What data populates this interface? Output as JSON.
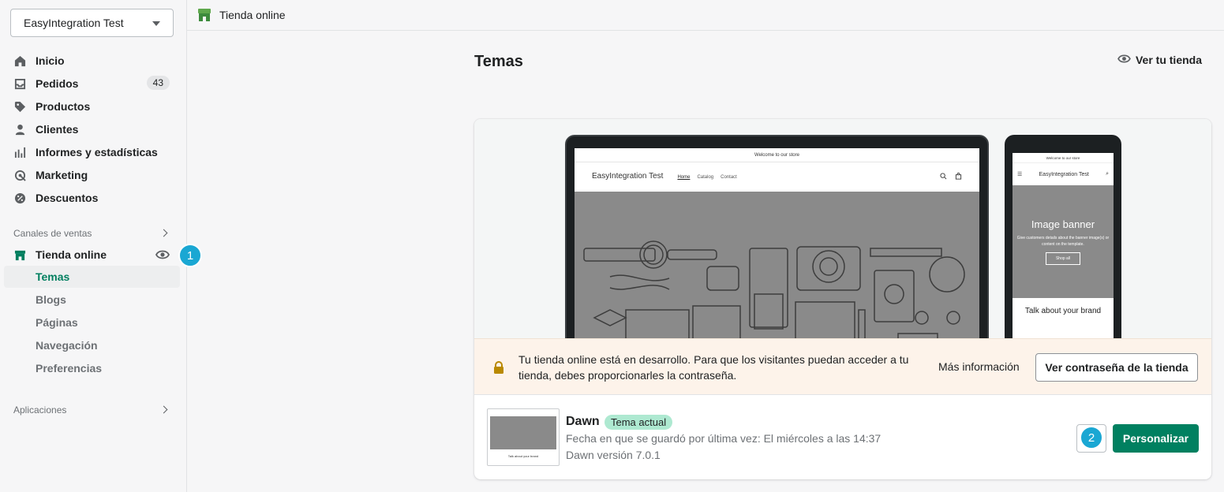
{
  "sidebar": {
    "store_name": "EasyIntegration Test",
    "items": [
      {
        "label": "Inicio",
        "icon": "home-icon"
      },
      {
        "label": "Pedidos",
        "icon": "orders-icon",
        "badge": "43"
      },
      {
        "label": "Productos",
        "icon": "tag-icon"
      },
      {
        "label": "Clientes",
        "icon": "person-icon"
      },
      {
        "label": "Informes y estadísticas",
        "icon": "bar-chart-icon"
      },
      {
        "label": "Marketing",
        "icon": "target-icon"
      },
      {
        "label": "Descuentos",
        "icon": "discount-icon"
      }
    ],
    "sales_channels_label": "Canales de ventas",
    "online_store_label": "Tienda online",
    "sub_items": [
      "Temas",
      "Blogs",
      "Páginas",
      "Navegación",
      "Preferencias"
    ],
    "apps_label": "Aplicaciones",
    "step1": "1"
  },
  "topbar": {
    "title": "Tienda online"
  },
  "main": {
    "page_title": "Temas",
    "view_store": "Ver tu tienda",
    "preview": {
      "announce": "Welcome to our store",
      "brand": "EasyIntegration Test",
      "links": [
        "Home",
        "Catalog",
        "Contact"
      ],
      "phone_banner_title": "Image banner",
      "phone_banner_sub": "Give customers details about the banner image(s) or content on the template.",
      "phone_shop": "Shop all",
      "phone_talk": "Talk about your brand"
    },
    "notice": {
      "message": "Tu tienda online está en desarrollo. Para que los visitantes puedan acceder a tu tienda, debes proporcionarles la contraseña.",
      "more": "Más información",
      "password_button": "Ver contraseña de la tienda"
    },
    "theme": {
      "name": "Dawn",
      "badge": "Tema actual",
      "saved": "Fecha en que se guardó por última vez: El miércoles a las 14:37",
      "version": "Dawn versión 7.0.1",
      "thumb_text": "Talk about your brand",
      "step2": "2",
      "customize": "Personalizar"
    }
  },
  "colors": {
    "accent": "#008060",
    "step_badge": "#1aa7d3",
    "badge_green": "#aee9d1"
  }
}
